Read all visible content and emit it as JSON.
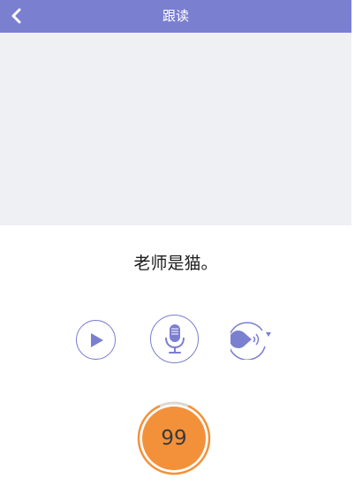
{
  "header": {
    "title": "跟读",
    "back_icon": "chevron-left-icon"
  },
  "practice": {
    "sentence": "老师是猫。"
  },
  "controls": {
    "play_icon": "play-icon",
    "record_icon": "microphone-icon",
    "replay_icon": "replay-recording-icon"
  },
  "score": {
    "value": "99"
  },
  "colors": {
    "accent": "#7b7fd0",
    "score_fill": "#f3913a",
    "media_bg": "#eff0f4"
  }
}
